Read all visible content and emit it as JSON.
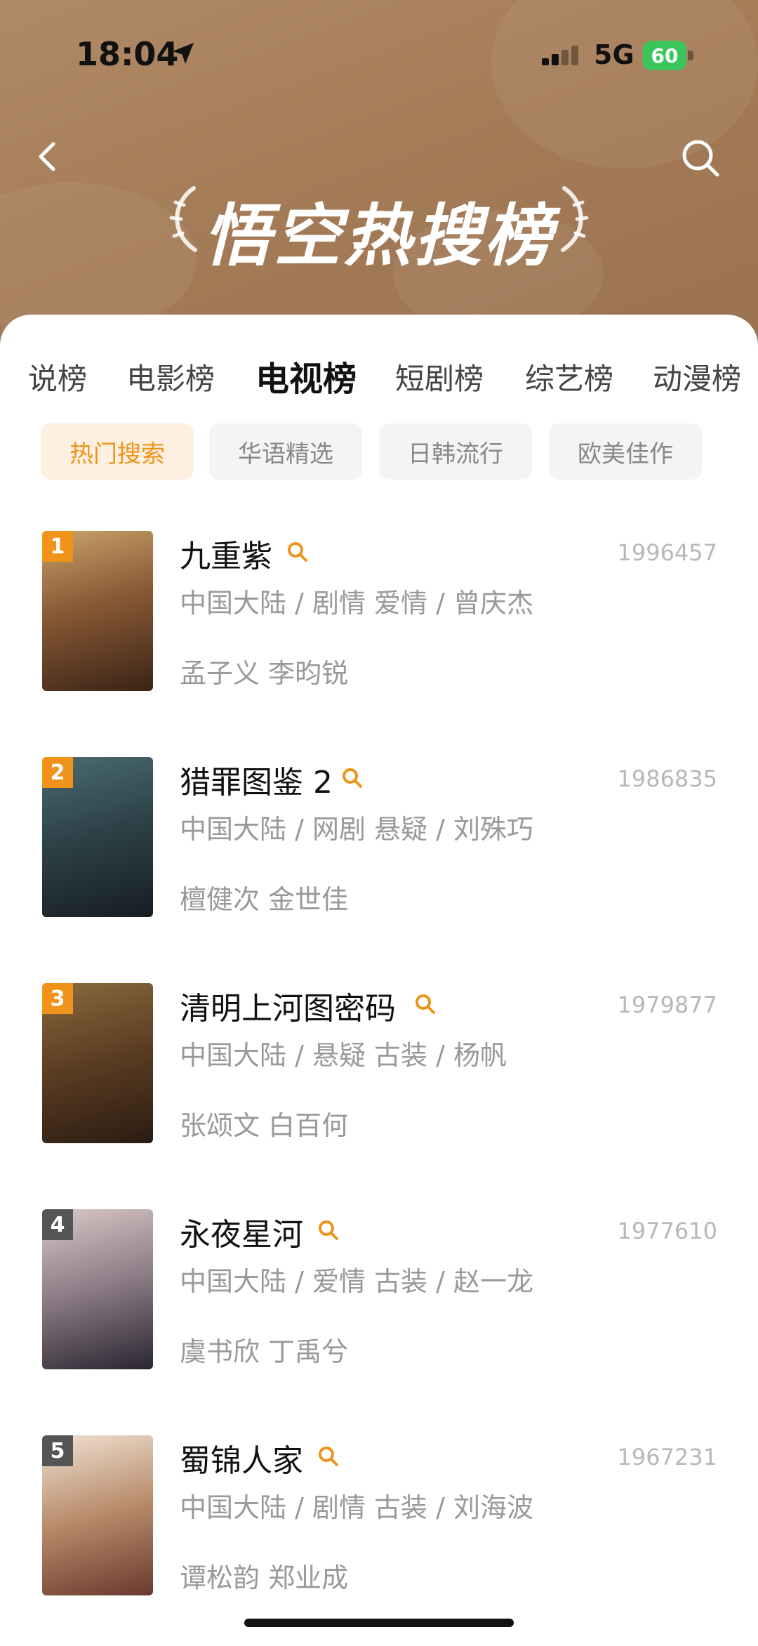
{
  "status_bar": {
    "time": "18:04",
    "network": "5G",
    "battery": "60"
  },
  "header": {
    "title": "悟空热搜榜"
  },
  "category_tabs": [
    "说榜",
    "电影榜",
    "电视榜",
    "短剧榜",
    "综艺榜",
    "动漫榜"
  ],
  "active_tab": "电视榜",
  "filter_chips": [
    "热门搜索",
    "华语精选",
    "日韩流行",
    "欧美佳作"
  ],
  "active_chip": "热门搜索",
  "colors": {
    "accent": "#f0931a",
    "rank_top3": "#f0931a",
    "rank_other": "#555555",
    "header_bg": "#a57c58"
  },
  "items": [
    {
      "rank": "1",
      "title": "九重紫",
      "score": "1996457",
      "meta": "中国大陆 / 剧情 爱情 / 曾庆杰",
      "cast": "孟子义 李昀锐"
    },
    {
      "rank": "2",
      "title": "猎罪图鉴 2",
      "score": "1986835",
      "meta": "中国大陆 / 网剧 悬疑 / 刘殊巧",
      "cast": "檀健次 金世佳"
    },
    {
      "rank": "3",
      "title": "清明上河图密码",
      "score": "1979877",
      "meta": "中国大陆 / 悬疑 古装 / 杨帆",
      "cast": "张颂文 白百何"
    },
    {
      "rank": "4",
      "title": "永夜星河",
      "score": "1977610",
      "meta": "中国大陆 / 爱情 古装 / 赵一龙",
      "cast": "虞书欣 丁禹兮"
    },
    {
      "rank": "5",
      "title": "蜀锦人家",
      "score": "1967231",
      "meta": "中国大陆 / 剧情 古装 / 刘海波",
      "cast": "谭松韵 郑业成"
    }
  ]
}
